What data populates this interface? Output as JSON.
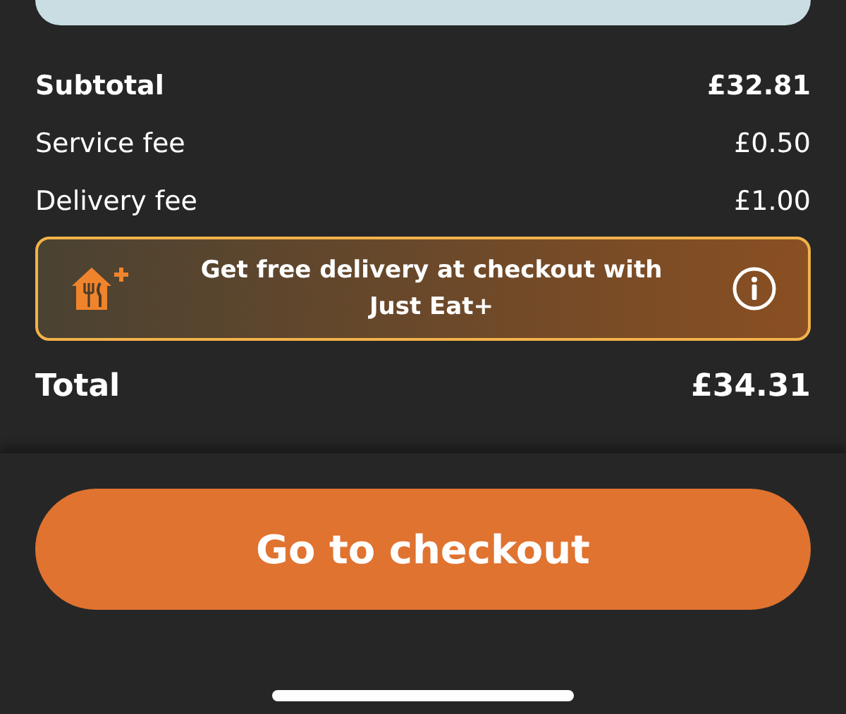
{
  "rows": [
    {
      "kind": "subtotal",
      "label": "Subtotal",
      "amount": "£32.81"
    },
    {
      "kind": "fee",
      "label": "Service fee",
      "amount": "£0.50"
    },
    {
      "kind": "fee",
      "label": "Delivery fee",
      "amount": "£1.00"
    }
  ],
  "promo": {
    "text": "Get free delivery at checkout with Just Eat+"
  },
  "total": {
    "label": "Total",
    "amount": "£34.31"
  },
  "checkout_button": {
    "label": "Go to checkout"
  }
}
